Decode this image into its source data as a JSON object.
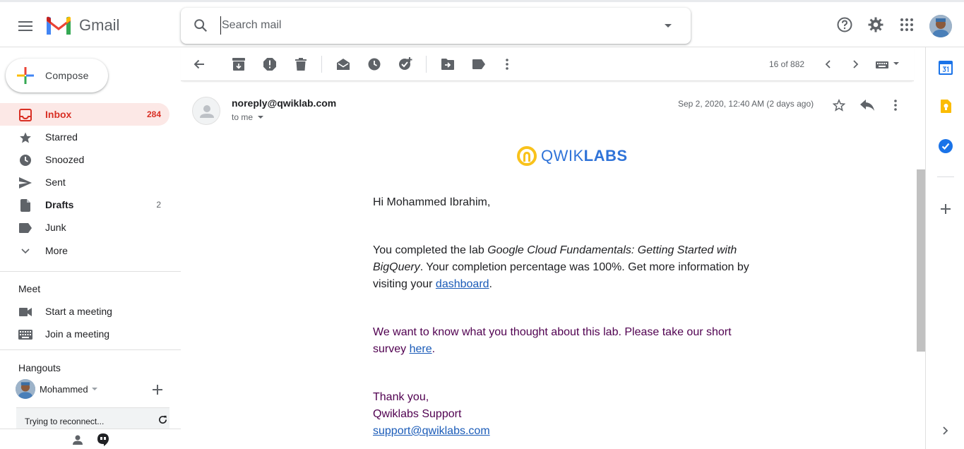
{
  "app": {
    "name": "Gmail"
  },
  "search": {
    "placeholder": "Search mail"
  },
  "compose": {
    "label": "Compose"
  },
  "nav": {
    "items": [
      {
        "label": "Inbox",
        "count": "284"
      },
      {
        "label": "Starred",
        "count": ""
      },
      {
        "label": "Snoozed",
        "count": ""
      },
      {
        "label": "Sent",
        "count": ""
      },
      {
        "label": "Drafts",
        "count": "2"
      },
      {
        "label": "Junk",
        "count": ""
      },
      {
        "label": "More",
        "count": ""
      }
    ]
  },
  "meet": {
    "title": "Meet",
    "start": "Start a meeting",
    "join": "Join a meeting"
  },
  "hangouts": {
    "title": "Hangouts",
    "user": "Mohammed",
    "status": "Trying to reconnect..."
  },
  "toolbar": {
    "pager": "16 of 882"
  },
  "message": {
    "sender": "noreply@qwiklab.com",
    "to": "to me",
    "date": "Sep 2, 2020, 12:40 AM (2 days ago)",
    "brand_light": "QWIK",
    "brand_bold": "LABS",
    "greeting": "Hi Mohammed Ibrahim,",
    "p1_a": "You completed the lab ",
    "p1_lab": "Google Cloud Fundamentals: Getting Started with BigQuery",
    "p1_b": ". Your completion percentage was 100%. Get more information by visiting your ",
    "p1_link": "dashboard",
    "p1_c": ".",
    "p2_a": "We want to know what you thought about this lab. Please take our short survey ",
    "p2_link": "here",
    "p2_b": ".",
    "thanks": "Thank you,",
    "signature": "Qwiklabs Support",
    "support_email": "support@qwiklabs.com"
  },
  "colors": {
    "accent_red": "#d93025",
    "active_bg": "#fce8e6",
    "link": "#1a5bb8",
    "purple_text": "#500050",
    "brand_blue": "#2f73d8",
    "brand_yellow": "#f9c21b"
  }
}
